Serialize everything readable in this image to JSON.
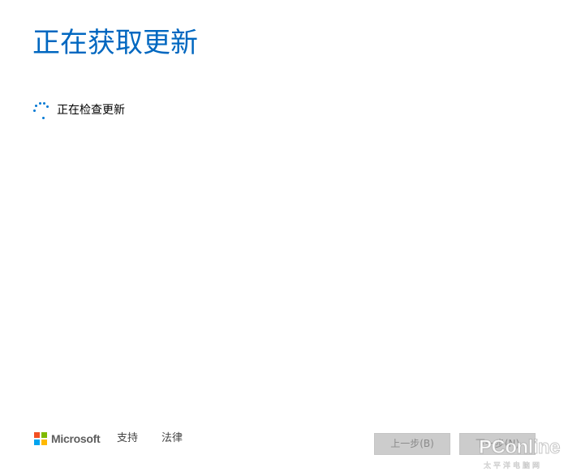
{
  "main": {
    "heading": "正在获取更新",
    "status_text": "正在检查更新"
  },
  "footer": {
    "brand": "Microsoft",
    "links": [
      {
        "label": "支持"
      },
      {
        "label": "法律"
      }
    ],
    "buttons": {
      "back_label": "上一步(B)",
      "next_label": "下一步(N)"
    }
  },
  "watermark": {
    "main": "PConline",
    "sub": "太平洋电脑网"
  },
  "colors": {
    "heading": "#0067c0",
    "spinner": "#0078d4",
    "button_disabled_bg": "#cccccc",
    "button_disabled_text": "#8a8a8a",
    "ms_red": "#f25022",
    "ms_green": "#7fba00",
    "ms_blue": "#00a4ef",
    "ms_yellow": "#ffb900"
  },
  "icons": {
    "spinner": "loading-spinner-icon",
    "logo": "microsoft-logo-icon"
  }
}
